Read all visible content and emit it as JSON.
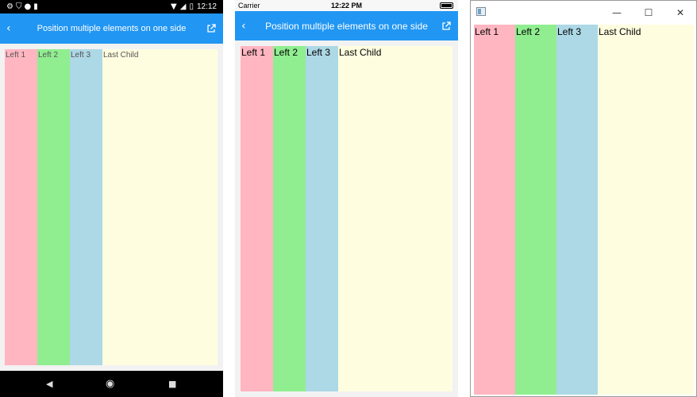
{
  "colors": {
    "left1": "#ffb6c1",
    "left2": "#90ee90",
    "left3": "#add8e6",
    "last_child": "#fffde0",
    "nav_blue": "#2196f3"
  },
  "page_title": "Position multiple elements on one side",
  "labels": {
    "left1": "Left 1",
    "left2": "Left 2",
    "left3": "Left 3",
    "last_child": "Last Child"
  },
  "android": {
    "clock": "12:12",
    "status_icons_left": [
      "gear-icon",
      "shield-icon",
      "circle-icon",
      "sd-card-icon"
    ],
    "status_icons_right": [
      "wifi-icon",
      "signal-icon",
      "battery-icon"
    ],
    "nav_buttons": [
      "back-triangle-icon",
      "home-circle-icon",
      "recents-square-icon"
    ]
  },
  "ios": {
    "carrier": "Carrier",
    "clock": "12:22 PM"
  },
  "windows": {
    "controls": [
      "minimize",
      "maximize",
      "close"
    ]
  }
}
